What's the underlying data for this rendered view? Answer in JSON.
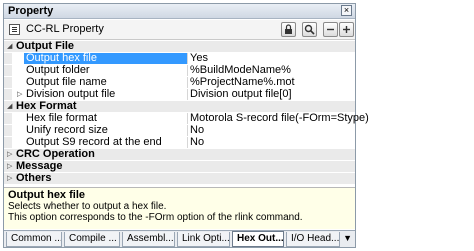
{
  "window": {
    "title": "Property",
    "close_glyph": "×"
  },
  "toolbar": {
    "label": "CC-RL Property",
    "buttons": [
      {
        "icon": "lock-icon",
        "glyph": "🔒"
      },
      {
        "icon": "search-icon",
        "glyph": "🔍"
      },
      {
        "icon": "collapse-icon",
        "glyph": "−"
      },
      {
        "icon": "expand-icon",
        "glyph": "+"
      }
    ]
  },
  "grid": {
    "output_file": {
      "label": "Output File"
    },
    "output_hex_file": {
      "name": "Output hex file",
      "value": "Yes"
    },
    "output_folder": {
      "name": "Output folder",
      "value": "%BuildModeName%"
    },
    "output_file_name": {
      "name": "Output file name",
      "value": "%ProjectName%.mot"
    },
    "division_output_file": {
      "name": "Division output file",
      "value": "Division output file[0]"
    },
    "hex_format": {
      "label": "Hex Format"
    },
    "hex_file_format": {
      "name": "Hex file format",
      "value": "Motorola S-record file(-FOrm=Stype)"
    },
    "unify_record_size": {
      "name": "Unify record size",
      "value": "No"
    },
    "output_s9": {
      "name": "Output S9 record at the end",
      "value": "No"
    },
    "crc_operation": {
      "label": "CRC Operation"
    },
    "message": {
      "label": "Message"
    },
    "others": {
      "label": "Others"
    }
  },
  "description": {
    "title": "Output hex file",
    "line1": "Selects whether to output a hex file.",
    "line2": "This option corresponds to the -FOrm option of the rlink command."
  },
  "tabs": {
    "t1": "Common ...",
    "t2": "Compile ...",
    "t3": "Assembl...",
    "t4": "Link Opti...",
    "t5": "Hex Out...",
    "t6": "I/O Head..."
  }
}
